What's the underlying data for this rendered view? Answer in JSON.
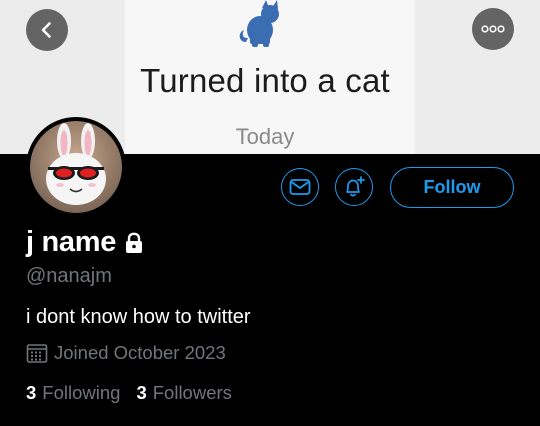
{
  "banner": {
    "title": "Turned into a cat",
    "subtitle": "Today",
    "cat_icon": "cat-silhouette-icon",
    "cat_color": "#3b6db3"
  },
  "nav": {
    "back_icon": "chevron-left-icon",
    "more_icon": "ellipsis-icon"
  },
  "profile": {
    "display_name": "j name",
    "handle": "@nanajm",
    "bio": "i dont know how to twitter",
    "joined": "Joined October 2023",
    "protected_icon": "lock-icon",
    "avatar_icon": "rabbit-with-sunglasses-avatar"
  },
  "actions": {
    "message_icon": "envelope-icon",
    "notify_icon": "bell-plus-icon",
    "follow_label": "Follow"
  },
  "stats": {
    "following_count": "3",
    "following_label": "Following",
    "followers_count": "3",
    "followers_label": "Followers"
  },
  "colors": {
    "accent": "#1d9bf0",
    "background": "#000000",
    "secondary_text": "#71767b"
  }
}
